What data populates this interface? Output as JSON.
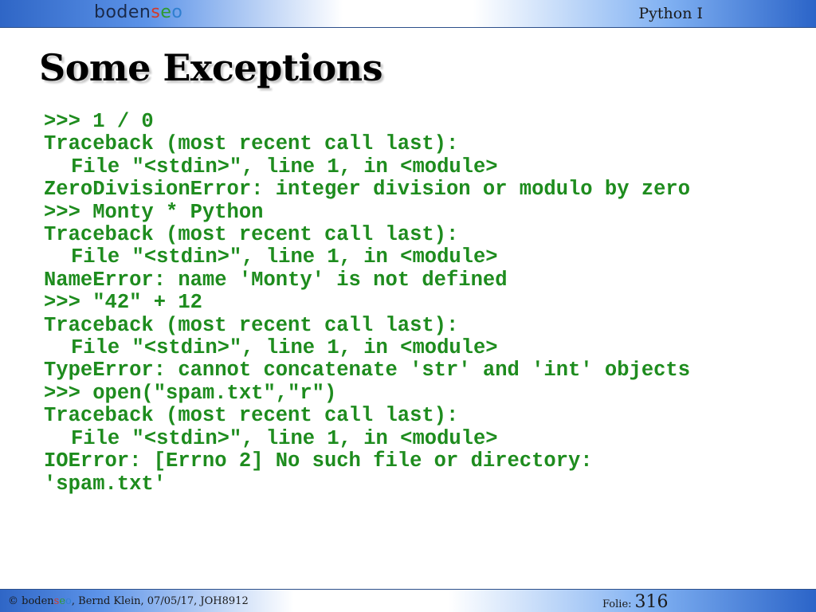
{
  "header": {
    "logo": {
      "part_dark": "boden",
      "part_s": "s",
      "part_e": "e",
      "part_o": "o"
    },
    "course": "Python I"
  },
  "slide": {
    "title": "Some Exceptions",
    "code_lines": [
      {
        "text": ">>> 1 / 0",
        "indent": false
      },
      {
        "text": "Traceback (most recent call last):",
        "indent": false
      },
      {
        "text": "File \"<stdin>\", line 1, in <module>",
        "indent": true
      },
      {
        "text": "ZeroDivisionError: integer division or modulo by zero",
        "indent": false
      },
      {
        "text": ">>> Monty * Python",
        "indent": false
      },
      {
        "text": "Traceback (most recent call last):",
        "indent": false
      },
      {
        "text": "File \"<stdin>\", line 1, in <module>",
        "indent": true
      },
      {
        "text": "NameError: name 'Monty' is not defined",
        "indent": false
      },
      {
        "text": ">>> \"42\" + 12",
        "indent": false
      },
      {
        "text": "Traceback (most recent call last):",
        "indent": false
      },
      {
        "text": "File \"<stdin>\", line 1, in <module>",
        "indent": true
      },
      {
        "text": "TypeError: cannot concatenate 'str' and 'int' objects",
        "indent": false
      },
      {
        "text": ">>> open(\"spam.txt\",\"r\")",
        "indent": false
      },
      {
        "text": "Traceback (most recent call last):",
        "indent": false
      },
      {
        "text": "File \"<stdin>\", line 1, in <module>",
        "indent": true
      },
      {
        "text": "IOError: [Errno 2] No such file or directory:",
        "indent": false
      },
      {
        "text": "'spam.txt'",
        "indent": false
      }
    ]
  },
  "footer": {
    "copyright_prefix": "© boden",
    "copyright_s": "s",
    "copyright_e": "e",
    "copyright_o": "o",
    "copyright_rest": ", Bernd Klein, 07/05/17, JOH8912",
    "folie_label": "Folie:",
    "folie_number": "316"
  },
  "colors": {
    "code_green": "#1e8c1e",
    "logo_red": "#d23a2a",
    "logo_green": "#2f9a2f",
    "logo_blue": "#2f7fd0",
    "bar_blue": "#2f66c6"
  }
}
